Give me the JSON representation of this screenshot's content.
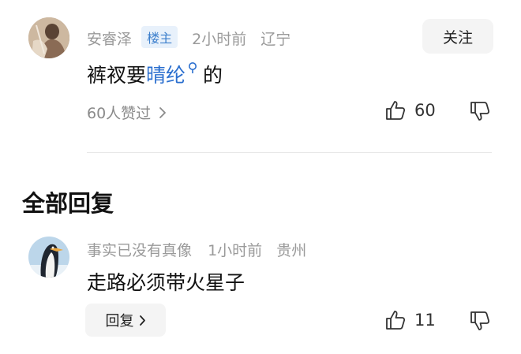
{
  "comment": {
    "author": "安睿泽",
    "badge": "楼主",
    "time": "2小时前",
    "location": "辽宁",
    "follow_label": "关注",
    "text_before": "裤衩要",
    "link_text": "晴纶",
    "text_after": "的",
    "likes_summary": "60人赞过",
    "like_count": "60"
  },
  "replies_section": {
    "title": "全部回复"
  },
  "reply": {
    "author": "事实已没有真像",
    "time": "1小时前",
    "location": "贵州",
    "text": "走路必须带火星子",
    "reply_button_label": "回复",
    "like_count": "11"
  },
  "colors": {
    "link": "#2b6fcf",
    "badge_bg": "#e8f1fb",
    "badge_text": "#3c7fcc"
  }
}
